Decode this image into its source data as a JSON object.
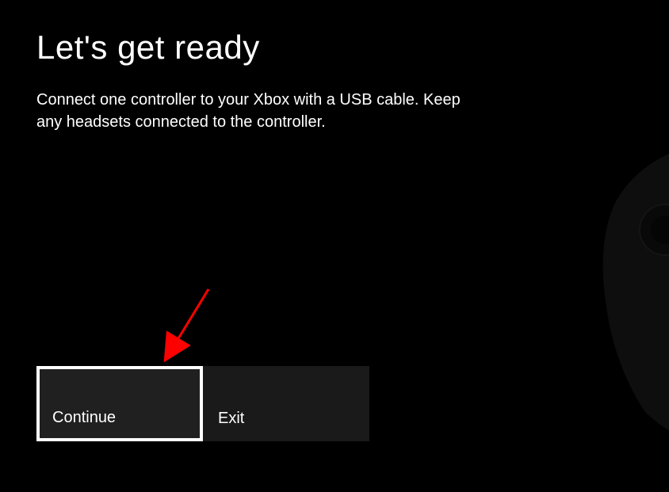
{
  "header": {
    "title": "Let's get ready"
  },
  "body": {
    "instruction": "Connect one controller to your Xbox with a USB cable. Keep any headsets connected to the controller."
  },
  "buttons": {
    "continue_label": "Continue",
    "exit_label": "Exit"
  },
  "annotation": {
    "arrow_color": "#ff0000"
  }
}
